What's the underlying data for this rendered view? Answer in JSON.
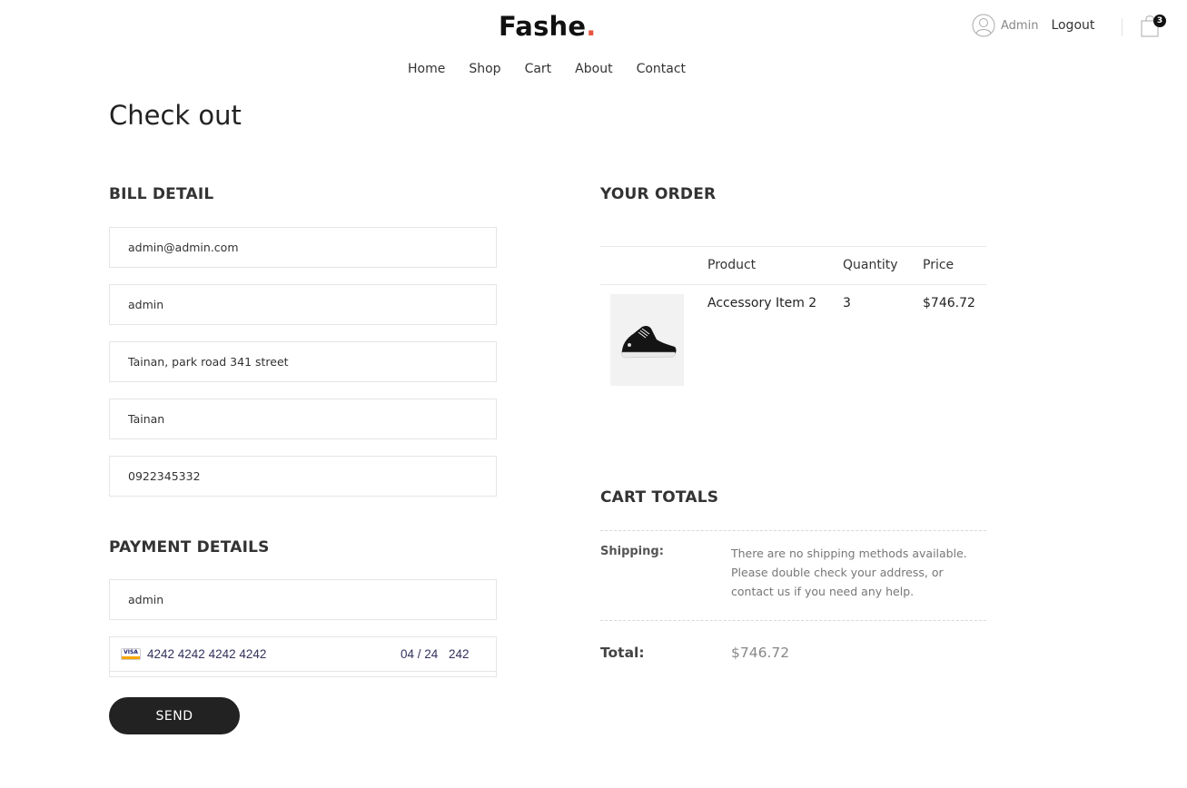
{
  "header": {
    "logo_text": "Fashe",
    "logo_dot": ".",
    "user_name": "Admin",
    "logout_label": "Logout",
    "cart_count": "3"
  },
  "nav": {
    "items": [
      "Home",
      "Shop",
      "Cart",
      "About",
      "Contact"
    ]
  },
  "page": {
    "title": "Check out"
  },
  "bill_detail": {
    "title": "BILL DETAIL",
    "email": "admin@admin.com",
    "name": "admin",
    "address": "Tainan, park road 341 street",
    "city": "Tainan",
    "phone": "0922345332"
  },
  "payment_details": {
    "title": "PAYMENT DETAILS",
    "cardholder": "admin",
    "card_brand": "VISA",
    "card_number": "4242 4242 4242 4242",
    "card_expiry": "04 / 24",
    "card_cvc": "242",
    "submit_label": "SEND"
  },
  "order": {
    "title": "YOUR ORDER",
    "columns": [
      "Product",
      "Quantity",
      "Price"
    ],
    "rows": [
      {
        "product": "Accessory Item 2",
        "quantity": "3",
        "price": "$746.72"
      }
    ]
  },
  "cart_totals": {
    "title": "CART TOTALS",
    "shipping_label": "Shipping:",
    "shipping_text": "There are no shipping methods available. Please double check your address, or contact us if you need any help.",
    "total_label": "Total:",
    "total_value": "$746.72"
  },
  "colors": {
    "accent": "#e65540",
    "button": "#222222",
    "card_text": "#32325d"
  }
}
